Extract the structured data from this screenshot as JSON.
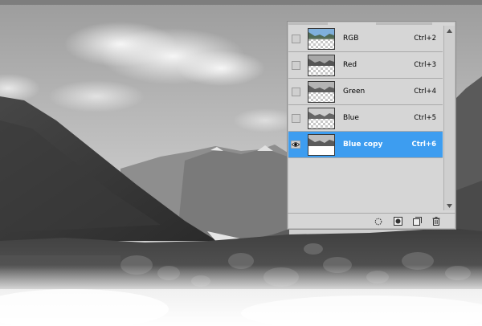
{
  "panel": {
    "channels": [
      {
        "name": "RGB",
        "shortcut": "Ctrl+2",
        "visible": false,
        "selected": false
      },
      {
        "name": "Red",
        "shortcut": "Ctrl+3",
        "visible": false,
        "selected": false
      },
      {
        "name": "Green",
        "shortcut": "Ctrl+4",
        "visible": false,
        "selected": false
      },
      {
        "name": "Blue",
        "shortcut": "Ctrl+5",
        "visible": false,
        "selected": false
      },
      {
        "name": "Blue copy",
        "shortcut": "Ctrl+6",
        "visible": true,
        "selected": true
      }
    ],
    "icons": {
      "visibility": "eye-icon",
      "scroll_up": "triangle-up-icon",
      "scroll_down": "triangle-down-icon",
      "toolbar": [
        "load-channel-as-selection-icon",
        "save-selection-as-channel-icon",
        "new-channel-icon",
        "trash-icon"
      ]
    }
  },
  "colors": {
    "panel_bg": "#d6d6d6",
    "selection": "#3d9df0",
    "text": "#000000",
    "text_selected": "#ffffff"
  }
}
